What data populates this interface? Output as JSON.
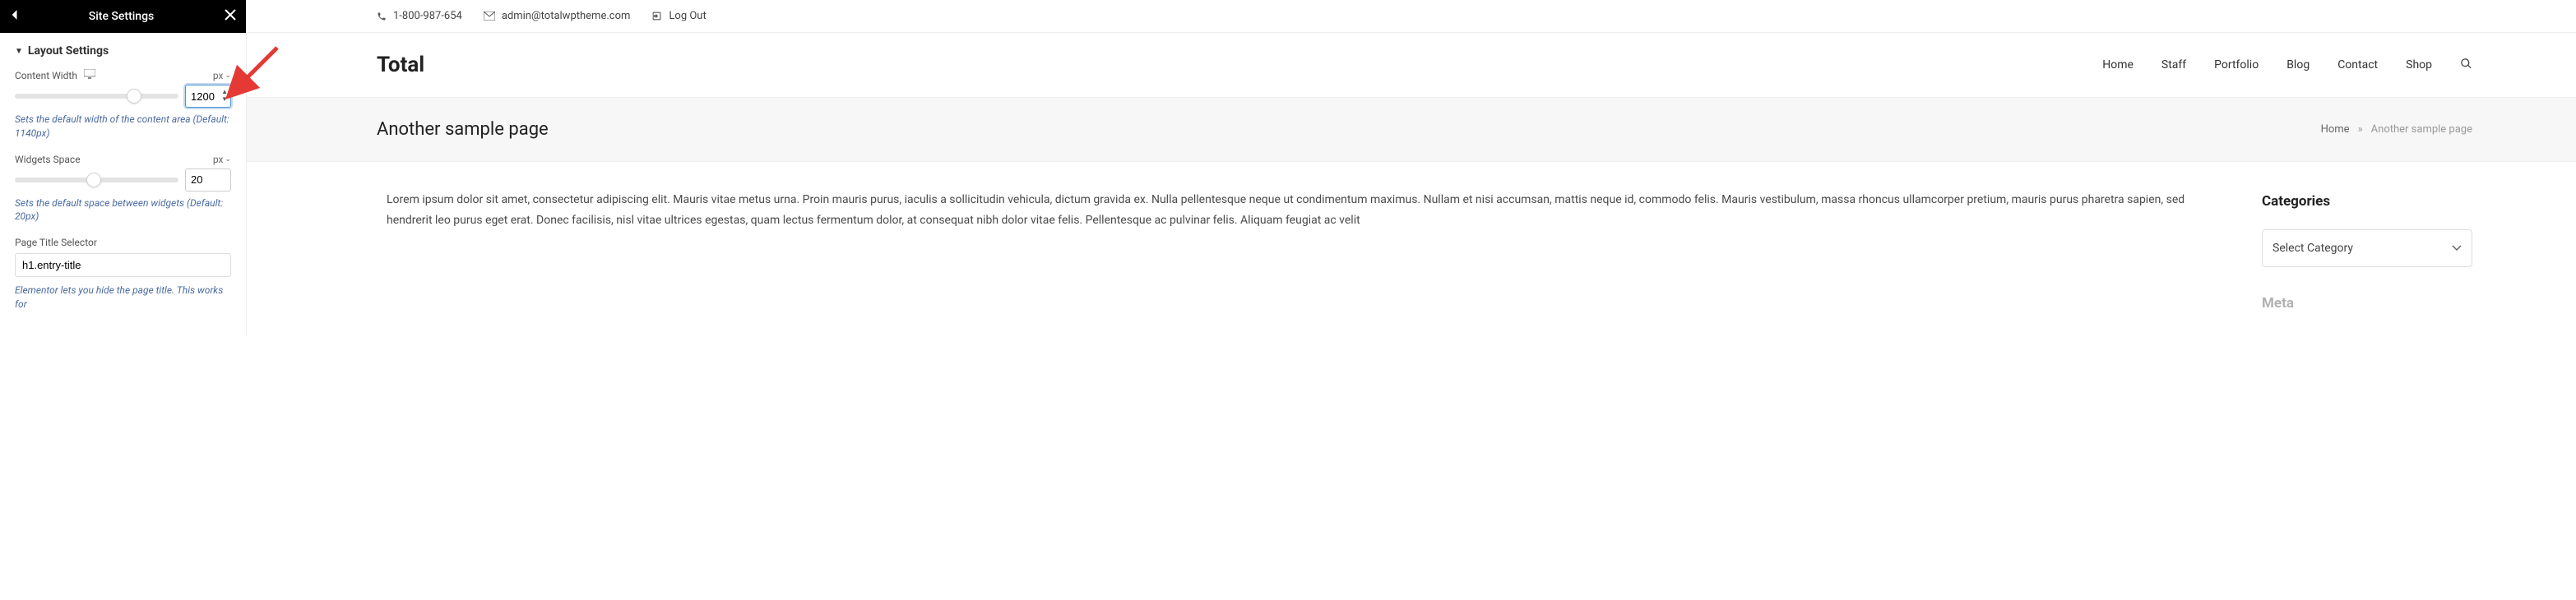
{
  "sidebar": {
    "title": "Site Settings",
    "section": "Layout Settings",
    "contentWidth": {
      "label": "Content Width",
      "unit": "px",
      "value": "1200",
      "help": "Sets the default width of the content area (Default: 1140px)"
    },
    "widgetsSpace": {
      "label": "Widgets Space",
      "unit": "px",
      "value": "20",
      "help": "Sets the default space between widgets (Default: 20px)"
    },
    "titleSelector": {
      "label": "Page Title Selector",
      "value": "h1.entry-title",
      "help": "Elementor lets you hide the page title. This works for"
    }
  },
  "preview": {
    "topbar": {
      "phone": "1-800-987-654",
      "email": "admin@totalwptheme.com",
      "logout": "Log Out"
    },
    "logo": "Total",
    "nav": [
      "Home",
      "Staff",
      "Portfolio",
      "Blog",
      "Contact",
      "Shop"
    ],
    "pageTitle": "Another sample page",
    "breadcrumb": {
      "home": "Home",
      "sep": "»",
      "current": "Another sample page"
    },
    "body": "Lorem ipsum dolor sit amet, consectetur adipiscing elit. Mauris vitae metus urna. Proin mauris purus, iaculis a sollicitudin vehicula, dictum gravida ex. Nulla pellentesque neque ut condimentum maximus. Nullam et nisi accumsan, mattis neque id, commodo felis. Mauris vestibulum, massa rhoncus ullamcorper pretium, mauris purus pharetra sapien, sed hendrerit leo purus eget erat. Donec facilisis, nisl vitae ultrices egestas, quam lectus fermentum dolor, at consequat nibh dolor vitae felis. Pellentesque ac pulvinar felis. Aliquam feugiat ac velit",
    "sidebarWidgets": {
      "categoriesTitle": "Categories",
      "categoriesPlaceholder": "Select Category",
      "metaTitle": "Meta"
    }
  }
}
